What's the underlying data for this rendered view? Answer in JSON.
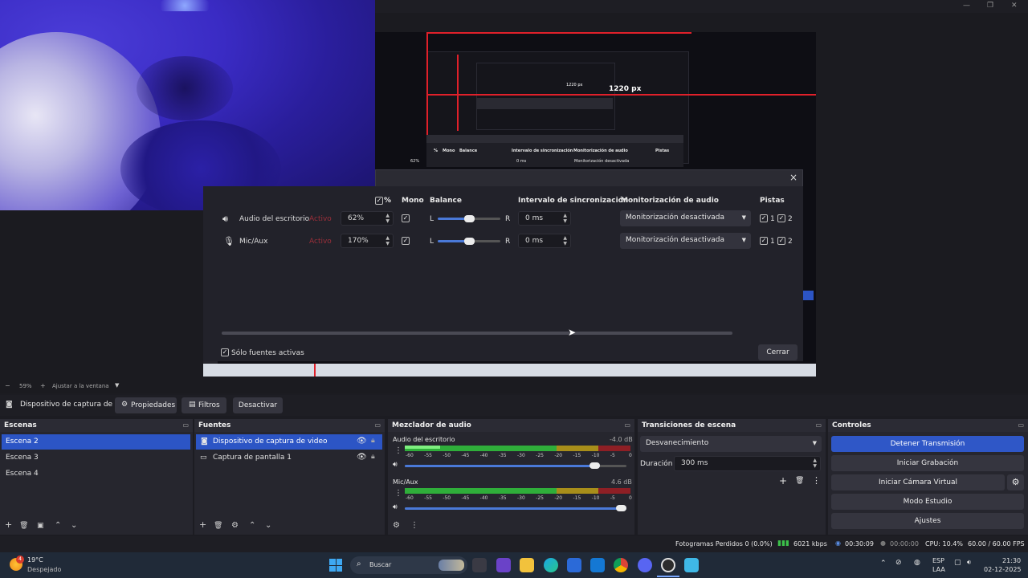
{
  "dialog": {
    "headers": {
      "pct": "%",
      "mono": "Mono",
      "balance": "Balance",
      "sync": "Intervalo de sincronización",
      "monitor": "Monitorización de audio",
      "tracks": "Pistas"
    },
    "rows": [
      {
        "name": "Audio del escritorio",
        "status": "Activo",
        "volume": "62%",
        "mono": true,
        "balance_left": "L",
        "balance_right": "R",
        "balance_value": 0.5,
        "sync": "0 ms",
        "monitor": "Monitorización desactivada",
        "track1": "1",
        "track2": "2"
      },
      {
        "name": "Mic/Aux",
        "status": "Activo",
        "volume": "170%",
        "mono": true,
        "balance_left": "L",
        "balance_right": "R",
        "balance_value": 0.5,
        "sync": "0 ms",
        "monitor": "Monitorización desactivada",
        "track1": "1",
        "track2": "2"
      }
    ],
    "only_active_label": "Sólo fuentes activas",
    "close_label": "Cerrar",
    "close_icon": "×"
  },
  "nested_preview": {
    "width_label": "1220 px",
    "small_label": "1220 px",
    "mini_headers": {
      "pct": "%",
      "mono": "Mono",
      "balance": "Balance",
      "sync": "Intervalo de sincronización",
      "monitor": "Monitorización de audio",
      "tracks": "Pistas"
    },
    "mini_row": {
      "volume": "62%",
      "sync": "0 ms",
      "monitor": "Monitorización desactivada"
    }
  },
  "zoom": {
    "level": "59%",
    "fit_label": "Ajustar a la ventana"
  },
  "source_toolbar": {
    "source_name": "Dispositivo de captura de v",
    "properties": "Propiedades",
    "filters": "Filtros",
    "deactivate": "Desactivar"
  },
  "scenes": {
    "title": "Escenas",
    "items": [
      "Escena 2",
      "Escena 3",
      "Escena 4"
    ],
    "selected": 0
  },
  "sources": {
    "title": "Fuentes",
    "items": [
      "Dispositivo de captura de video",
      "Captura de pantalla 1"
    ],
    "selected": 0
  },
  "mixer": {
    "title": "Mezclador de audio",
    "channels": [
      {
        "name": "Audio del escritorio",
        "db": "-4.0 dB",
        "volume_fraction": 0.88
      },
      {
        "name": "Mic/Aux",
        "db": "4.6 dB",
        "volume_fraction": 1.0
      }
    ],
    "scale": [
      "-60",
      "-55",
      "-50",
      "-45",
      "-40",
      "-35",
      "-30",
      "-25",
      "-20",
      "-15",
      "-10",
      "-5",
      "0"
    ]
  },
  "transitions": {
    "title": "Transiciones de escena",
    "current": "Desvanecimiento",
    "duration_label": "Duración",
    "duration_value": "300 ms"
  },
  "controls": {
    "title": "Controles",
    "buttons": [
      "Detener Transmisión",
      "Iniciar Grabación",
      "Iniciar Cámara Virtual",
      "Modo Estudio",
      "Ajustes"
    ]
  },
  "status": {
    "dropped": "Fotogramas Perdidos 0 (0.0%)",
    "bitrate": "6021 kbps",
    "stream_time": "00:30:09",
    "rec_time": "00:00:00",
    "cpu": "CPU: 10.4%",
    "fps": "60.00 / 60.00 FPS"
  },
  "taskbar": {
    "weather_temp": "19°C",
    "weather_desc": "Despejado",
    "search_placeholder": "Buscar",
    "lang_top": "ESP",
    "lang_bottom": "LAA",
    "time": "21:30",
    "date": "02-12-2025",
    "badge": "4"
  },
  "colors": {
    "accent": "#2c55c5",
    "active_text": "#9c2f3a",
    "meter_green": "#2fae3a",
    "meter_yellow": "#b59a1c",
    "meter_red": "#b3262c"
  }
}
